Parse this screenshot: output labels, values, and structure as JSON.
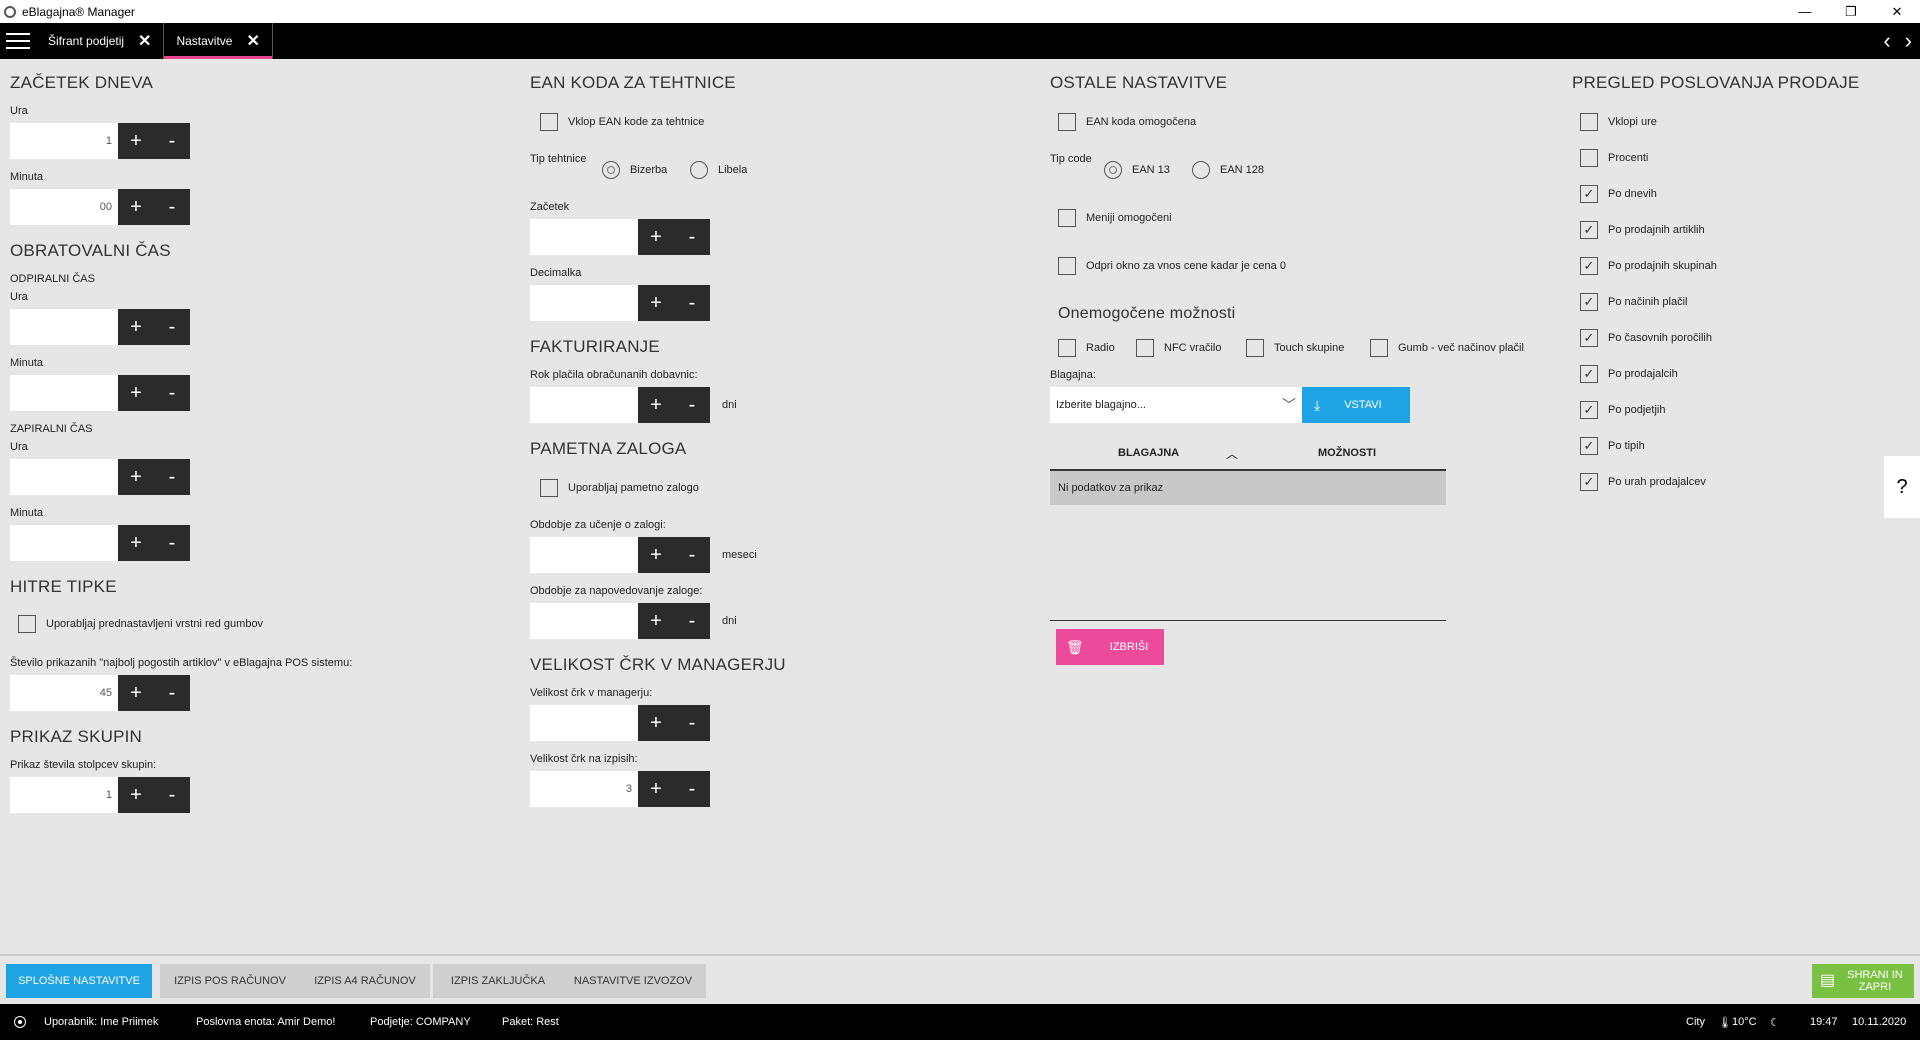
{
  "window": {
    "title": "eBlagajna® Manager",
    "minimize": "—",
    "restore": "❐",
    "close": "✕"
  },
  "tabs": [
    {
      "label": "Šifrant podjetij",
      "close": "✕"
    },
    {
      "label": "Nastavitve",
      "close": "✕"
    }
  ],
  "nav": {
    "back": "‹",
    "forward": "›"
  },
  "col1": {
    "zacetek": {
      "title": "ZAČETEK DNEVA",
      "ura_label": "Ura",
      "ura_value": "1",
      "minuta_label": "Minuta",
      "minuta_value": "00"
    },
    "obratovalni": {
      "title": "OBRATOVALNI ČAS",
      "odpiralni": "ODPIRALNI ČAS",
      "odp_ura_label": "Ura",
      "odp_ura_value": "",
      "odp_min_label": "Minuta",
      "odp_min_value": "",
      "zapiralni": "ZAPIRALNI ČAS",
      "zap_ura_label": "Ura",
      "zap_ura_value": "",
      "zap_min_label": "Minuta",
      "zap_min_value": ""
    },
    "hitre": {
      "title": "HITRE TIPKE",
      "checkbox": "Uporabljaj prednastavljeni vrstni red gumbov",
      "stevilo_label": "Število prikazanih \"najbolj pogostih artiklov\" v eBlagajna POS sistemu:",
      "stevilo_value": "45"
    },
    "skupine": {
      "title": "PRIKAZ SKUPIN",
      "label": "Prikaz števila stolpcev skupin:",
      "value": "1"
    }
  },
  "col2": {
    "ean": {
      "title": "EAN KODA ZA TEHTNICE",
      "checkbox": "Vklop EAN kode za tehtnice",
      "tip_label": "Tip tehtnice",
      "opt1": "Bizerba",
      "opt2": "Libela",
      "zacetek_label": "Začetek",
      "zacetek_value": "",
      "decimalka_label": "Decimalka",
      "decimalka_value": ""
    },
    "fakt": {
      "title": "FAKTURIRANJE",
      "label": "Rok plačila obračunanih dobavnic:",
      "value": "",
      "suffix": "dni"
    },
    "zaloga": {
      "title": "PAMETNA ZALOGA",
      "checkbox": "Uporabljaj pametno zalogo",
      "ucenje_label": "Obdobje za učenje o zalogi:",
      "ucenje_value": "",
      "ucenje_suffix": "meseci",
      "napoved_label": "Obdobje za napovedovanje zaloge:",
      "napoved_value": "",
      "napoved_suffix": "dni"
    },
    "crke": {
      "title": "VELIKOST ČRK V MANAGERJU",
      "manager_label": "Velikost črk v managerju:",
      "manager_value": "",
      "izpis_label": "Velikost črk na izpisih:",
      "izpis_value": "3"
    }
  },
  "col3": {
    "title": "OSTALE NASTAVITVE",
    "ean_chk": "EAN koda omogočena",
    "tip_code": "Tip code",
    "ean13": "EAN 13",
    "ean128": "EAN 128",
    "meniji": "Meniji omogočeni",
    "odpri": "Odpri okno za vnos cene kadar je cena 0",
    "onemogocene": "Onemogočene možnosti",
    "radio": "Radio",
    "nfc": "NFC vračilo",
    "touch": "Touch skupine",
    "gumb": "Gumb - več načinov plačil",
    "blagajna_label": "Blagajna:",
    "blagajna_placeholder": "Izberite blagajno...",
    "vstavi": "VSTAVI",
    "th_blagajna": "BLAGAJNA",
    "th_moznosti": "MOŽNOSTI",
    "no_data": "Ni podatkov za prikaz",
    "izbrisi": "IZBRIŠI"
  },
  "col4": {
    "title": "PREGLED POSLOVANJA PRODAJE",
    "items": [
      {
        "label": "Vklopi ure",
        "checked": false
      },
      {
        "label": "Procenti",
        "checked": false
      },
      {
        "label": "Po dnevih",
        "checked": true
      },
      {
        "label": "Po prodajnih artiklih",
        "checked": true
      },
      {
        "label": "Po prodajnih skupinah",
        "checked": true
      },
      {
        "label": "Po načinih plačil",
        "checked": true
      },
      {
        "label": "Po časovnih poročilih",
        "checked": true
      },
      {
        "label": "Po prodajalcih",
        "checked": true
      },
      {
        "label": "Po podjetjih",
        "checked": true
      },
      {
        "label": "Po tipih",
        "checked": true
      },
      {
        "label": "Po urah prodajalcev",
        "checked": true
      }
    ]
  },
  "help": "?",
  "bottom_tabs": [
    "SPLOŠNE NASTAVITVE",
    "IZPIS POS RAČUNOV",
    "IZPIS A4 RAČUNOV",
    "IZPIS ZAKLJUČKA",
    "NASTAVITVE IZVOZOV"
  ],
  "save": {
    "line1": "SHRANI IN",
    "line2": "ZAPRI"
  },
  "status": {
    "user": "Uporabnik: Ime Priimek",
    "unit": "Poslovna enota: Amir Demo!",
    "company": "Podjetje: COMPANY",
    "paket": "Paket: Rest",
    "city": "City",
    "temp": "10°C",
    "time": "19:47",
    "date": "10.11.2020"
  }
}
